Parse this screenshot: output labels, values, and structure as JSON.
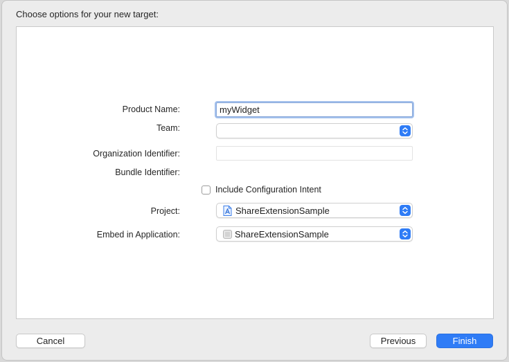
{
  "dialog": {
    "title": "Choose options for your new target:"
  },
  "form": {
    "product_name_label": "Product Name:",
    "product_name_value": "myWidget",
    "team_label": "Team:",
    "team_value": "",
    "org_id_label": "Organization Identifier:",
    "org_id_value": "",
    "bundle_id_label": "Bundle Identifier:",
    "bundle_id_value": "",
    "include_intent_label": "Include Configuration Intent",
    "include_intent_checked": false,
    "project_label": "Project:",
    "project_value": "ShareExtensionSample",
    "project_icon": "xcode-project-icon",
    "embed_label": "Embed in Application:",
    "embed_value": "ShareExtensionSample",
    "embed_icon": "app-icon"
  },
  "buttons": {
    "cancel": "Cancel",
    "previous": "Previous",
    "finish": "Finish"
  },
  "colors": {
    "accent": "#2f7cf6",
    "focus_ring": "#a3c0ec"
  }
}
